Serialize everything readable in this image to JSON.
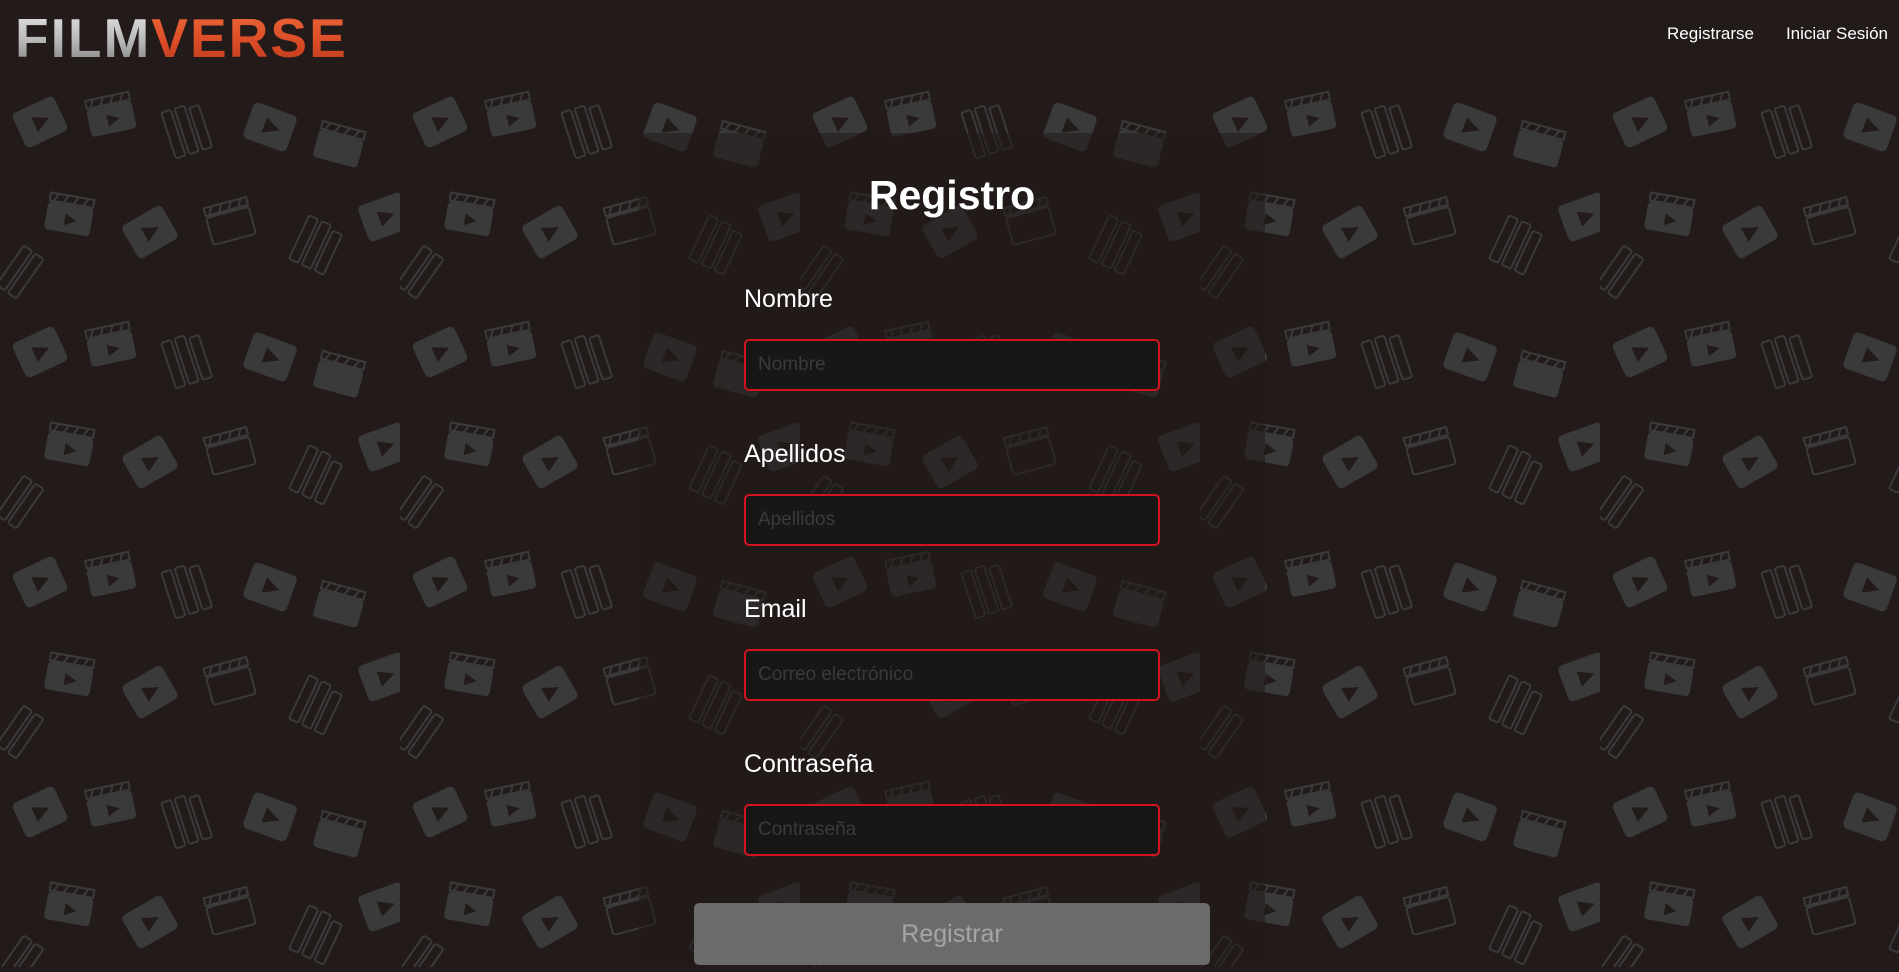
{
  "brand": {
    "part1": "FILM",
    "part2": "VERSE",
    "colors": {
      "film": "#d8d8d8",
      "verse": "#e0552d"
    }
  },
  "nav": {
    "register_label": "Registrarse",
    "login_label": "Iniciar Sesión"
  },
  "form": {
    "title": "Registro",
    "fields": {
      "nombre": {
        "label": "Nombre",
        "placeholder": "Nombre",
        "value": ""
      },
      "apellidos": {
        "label": "Apellidos",
        "placeholder": "Apellidos",
        "value": ""
      },
      "email": {
        "label": "Email",
        "placeholder": "Correo electrónico",
        "value": ""
      },
      "password": {
        "label": "Contraseña",
        "placeholder": "Contraseña",
        "value": ""
      }
    },
    "submit_label": "Registrar"
  },
  "background": {
    "pattern_icon": "clapperboard-play-icon",
    "base_color": "#231a1a",
    "icon_color": "#3a3a3a",
    "input_border_color": "#d3141f"
  }
}
